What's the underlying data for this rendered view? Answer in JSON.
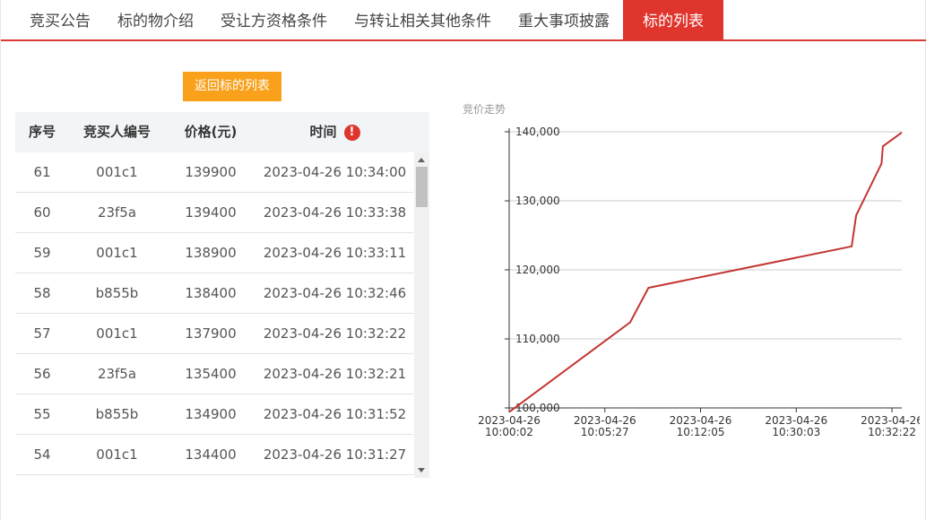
{
  "tabs": [
    {
      "label": "竞买公告"
    },
    {
      "label": "标的物介绍"
    },
    {
      "label": "受让方资格条件"
    },
    {
      "label": "与转让相关其他条件"
    },
    {
      "label": "重大事项披露"
    },
    {
      "label": "标的列表",
      "active": true
    }
  ],
  "back_button": "返回标的列表",
  "table": {
    "headers": {
      "no": "序号",
      "bidder": "竞买人编号",
      "price": "价格(元)",
      "time": "时间"
    },
    "time_header_icon": "warning-icon",
    "rows": [
      {
        "no": "61",
        "bidder": "001c1",
        "price": "139900",
        "time": "2023-04-26 10:34:00"
      },
      {
        "no": "60",
        "bidder": "23f5a",
        "price": "139400",
        "time": "2023-04-26 10:33:38"
      },
      {
        "no": "59",
        "bidder": "001c1",
        "price": "138900",
        "time": "2023-04-26 10:33:11"
      },
      {
        "no": "58",
        "bidder": "b855b",
        "price": "138400",
        "time": "2023-04-26 10:32:46"
      },
      {
        "no": "57",
        "bidder": "001c1",
        "price": "137900",
        "time": "2023-04-26 10:32:22"
      },
      {
        "no": "56",
        "bidder": "23f5a",
        "price": "135400",
        "time": "2023-04-26 10:32:21"
      },
      {
        "no": "55",
        "bidder": "b855b",
        "price": "134900",
        "time": "2023-04-26 10:31:52"
      },
      {
        "no": "54",
        "bidder": "001c1",
        "price": "134400",
        "time": "2023-04-26 10:31:27"
      }
    ]
  },
  "colors": {
    "accent": "#e0352d",
    "button": "#f9a11b",
    "line": "#c23531"
  },
  "chart_data": {
    "type": "line",
    "title": "竞价走势",
    "ylim": [
      100000,
      140000
    ],
    "y_ticks": [
      "100,000",
      "110,000",
      "120,000",
      "130,000",
      "140,000"
    ],
    "x_ticks": [
      {
        "date": "2023-04-26",
        "time": "10:00:02"
      },
      {
        "date": "2023-04-26",
        "time": "10:05:27"
      },
      {
        "date": "2023-04-26",
        "time": "10:12:05"
      },
      {
        "date": "2023-04-26",
        "time": "10:30:03"
      },
      {
        "date": "2023-04-26",
        "time": "10:32:22"
      }
    ],
    "grid": true,
    "series": [
      {
        "points": [
          {
            "x": "10:00:02",
            "y": 99400
          },
          {
            "x": "10:10:30",
            "y": 112400
          },
          {
            "x": "10:12:05",
            "y": 117400
          },
          {
            "x": "10:29:40",
            "y": 123400
          },
          {
            "x": "10:30:03",
            "y": 127900
          },
          {
            "x": "10:32:15",
            "y": 135400
          },
          {
            "x": "10:32:22",
            "y": 137900
          },
          {
            "x": "10:34:00",
            "y": 139900
          }
        ]
      }
    ]
  }
}
